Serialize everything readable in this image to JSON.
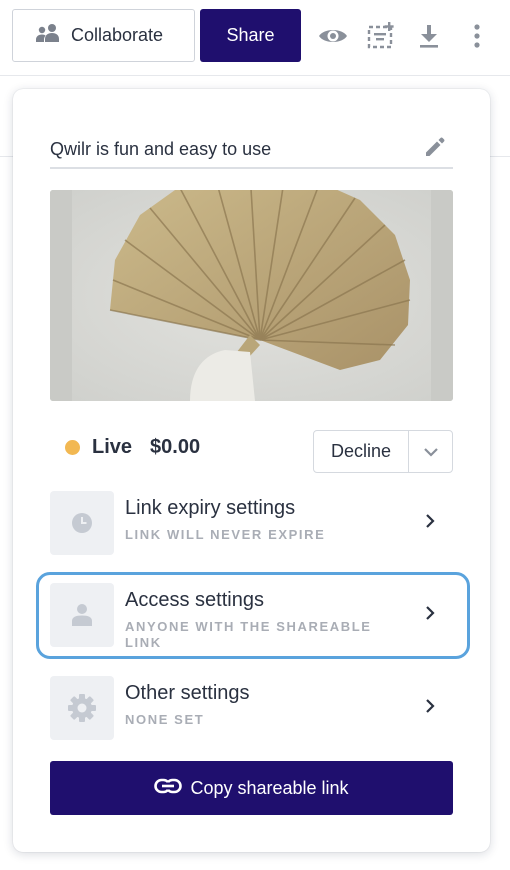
{
  "toolbar": {
    "collaborate_label": "Collaborate",
    "share_label": "Share",
    "icons": [
      "users-icon",
      "eye-icon",
      "add-block-icon",
      "download-icon",
      "more-vertical-icon"
    ]
  },
  "panel": {
    "title": "Qwilr is fun and easy to use",
    "status": {
      "label": "Live",
      "amount": "$0.00",
      "dot_color": "#f2b852"
    },
    "decline_label": "Decline",
    "settings": [
      {
        "title": "Link expiry settings",
        "subtitle": "LINK WILL NEVER EXPIRE",
        "icon": "clock-icon"
      },
      {
        "title": "Access settings",
        "subtitle": "ANYONE WITH THE SHAREABLE LINK",
        "icon": "person-icon"
      },
      {
        "title": "Other settings",
        "subtitle": "NONE SET",
        "icon": "gear-icon"
      }
    ],
    "copy_label": "Copy shareable link"
  },
  "colors": {
    "brand": "#1f0f6e",
    "focus": "#5aa3dd"
  }
}
